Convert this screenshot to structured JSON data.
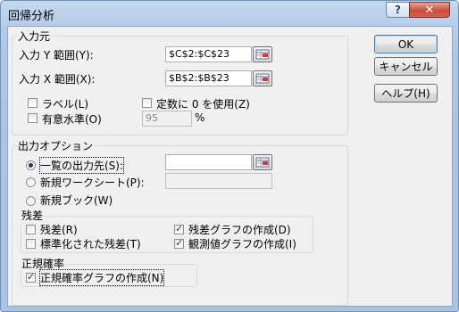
{
  "window": {
    "title": "回帰分析",
    "help_icon": "?",
    "close_icon": "✕"
  },
  "input": {
    "group_title": "入力元",
    "y_range_label": "入力 Y 範囲(Y):",
    "y_range_value": "$C$2:$C$23",
    "x_range_label": "入力 X 範囲(X):",
    "x_range_value": "$B$2:$B$23",
    "labels_label": "ラベル(L)",
    "labels_checked": false,
    "constant_zero_label": "定数に 0 を使用(Z)",
    "constant_zero_checked": false,
    "confidence_label": "有意水準(O)",
    "confidence_checked": false,
    "confidence_value": "95",
    "confidence_unit": "%"
  },
  "output": {
    "group_title": "出力オプション",
    "output_range_label": "一覧の出力先(S):",
    "output_range_selected": true,
    "output_range_value": "",
    "new_sheet_label": "新規ワークシート(P):",
    "new_sheet_value": "",
    "new_workbook_label": "新規ブック(W)"
  },
  "residuals": {
    "group_title": "残差",
    "residuals_label": "残差(R)",
    "residuals_checked": false,
    "standardized_label": "標準化された残差(T)",
    "standardized_checked": false,
    "residual_plots_label": "残差グラフの作成(D)",
    "residual_plots_checked": true,
    "line_fit_label": "観測値グラフの作成(I)",
    "line_fit_checked": true
  },
  "normal_probability": {
    "group_title": "正規確率",
    "plots_label": "正規確率グラフの作成(N)",
    "plots_checked": true
  },
  "buttons": {
    "ok": "OK",
    "cancel": "キャンセル",
    "help": "ヘルプ(H)"
  },
  "icons": {
    "range_selector": "range-selector-icon"
  },
  "colors": {
    "title_bar": "#b6cde9",
    "close_button": "#c94f3b",
    "client_bg": "#f0f0f0"
  }
}
